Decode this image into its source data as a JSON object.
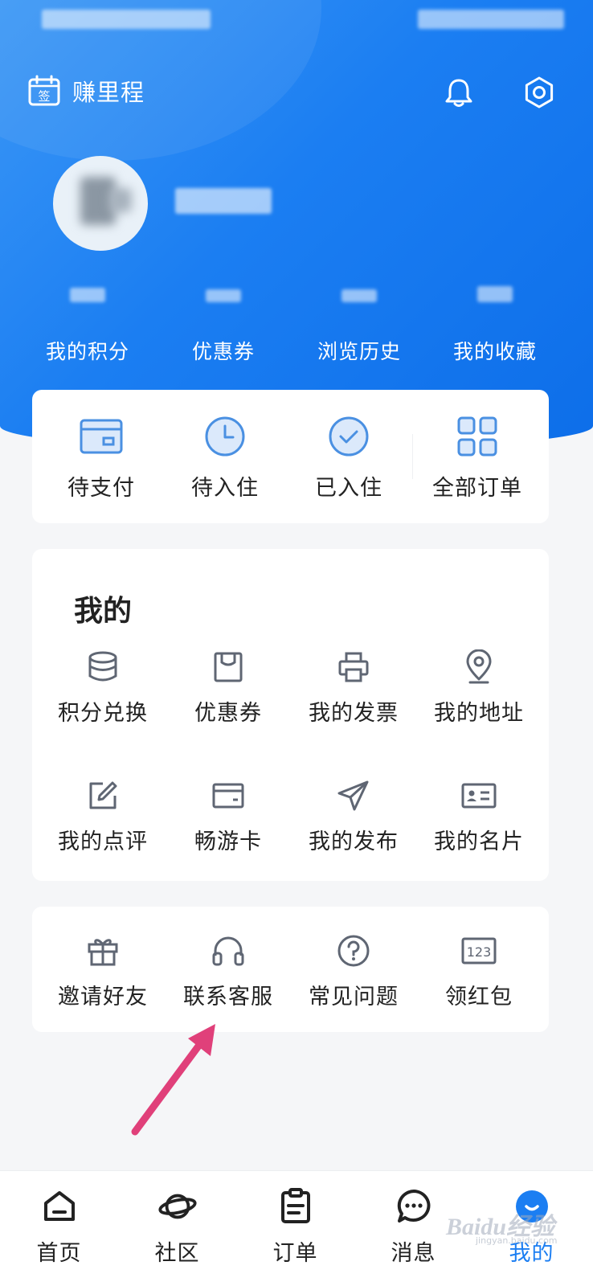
{
  "header": {
    "earn_label": "赚里程",
    "calendar_icon_text": "签"
  },
  "stats": [
    {
      "label": "我的积分"
    },
    {
      "label": "优惠券"
    },
    {
      "label": "浏览历史"
    },
    {
      "label": "我的收藏"
    }
  ],
  "orders": [
    {
      "label": "待支付",
      "icon": "wallet-icon"
    },
    {
      "label": "待入住",
      "icon": "clock-icon"
    },
    {
      "label": "已入住",
      "icon": "check-circle-icon"
    },
    {
      "label": "全部订单",
      "icon": "grid-icon"
    }
  ],
  "mine": {
    "title": "我的",
    "items": [
      {
        "label": "积分兑换",
        "icon": "coins-icon"
      },
      {
        "label": "优惠券",
        "icon": "coupon-icon"
      },
      {
        "label": "我的发票",
        "icon": "printer-icon"
      },
      {
        "label": "我的地址",
        "icon": "location-icon"
      },
      {
        "label": "我的点评",
        "icon": "edit-icon"
      },
      {
        "label": "畅游卡",
        "icon": "card-icon"
      },
      {
        "label": "我的发布",
        "icon": "send-icon"
      },
      {
        "label": "我的名片",
        "icon": "id-card-icon"
      }
    ]
  },
  "help": [
    {
      "label": "邀请好友",
      "icon": "gift-icon"
    },
    {
      "label": "联系客服",
      "icon": "headset-icon"
    },
    {
      "label": "常见问题",
      "icon": "question-icon"
    },
    {
      "label": "领红包",
      "icon": "keypad-icon",
      "icon_text": "123"
    }
  ],
  "tabs": [
    {
      "label": "首页",
      "icon": "home-icon"
    },
    {
      "label": "社区",
      "icon": "planet-icon"
    },
    {
      "label": "订单",
      "icon": "clipboard-icon"
    },
    {
      "label": "消息",
      "icon": "chat-icon"
    },
    {
      "label": "我的",
      "icon": "profile-icon",
      "active": true
    }
  ],
  "watermark": {
    "brand": "Baidu经验",
    "url": "jingyan.baidu.com"
  },
  "colors": {
    "accent": "#1b7ef2",
    "annotation_arrow": "#e0407a",
    "icon_blue": "#4a90e2",
    "icon_gray": "#5f6673"
  }
}
